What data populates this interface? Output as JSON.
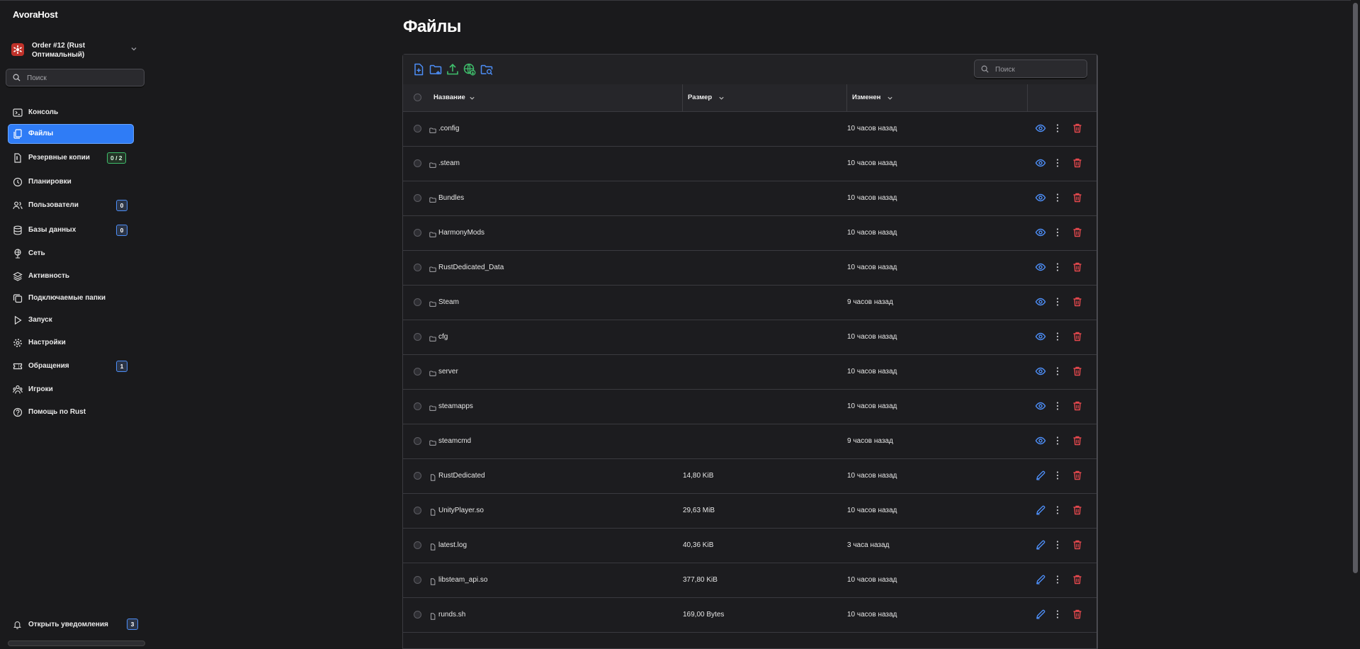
{
  "app": {
    "brand": "AvoraHost"
  },
  "order": {
    "title": "Order #12 (Rust Оптимальный)"
  },
  "sidebar": {
    "search_placeholder": "Поиск",
    "items": [
      {
        "label": "Консоль",
        "icon": "terminal-icon"
      },
      {
        "label": "Файлы",
        "icon": "files-icon",
        "active": true
      },
      {
        "label": "Резервные копии",
        "icon": "backup-icon",
        "badge": "0 / 2"
      },
      {
        "label": "Планировки",
        "icon": "clock-icon"
      },
      {
        "label": "Пользователи",
        "icon": "users-icon",
        "badge": "0"
      },
      {
        "label": "Базы данных",
        "icon": "database-icon",
        "badge": "0"
      },
      {
        "label": "Сеть",
        "icon": "network-icon"
      },
      {
        "label": "Активность",
        "icon": "layers-icon"
      },
      {
        "label": "Подключаемые папки",
        "icon": "mount-icon"
      },
      {
        "label": "Запуск",
        "icon": "play-icon"
      },
      {
        "label": "Настройки",
        "icon": "gear-icon"
      },
      {
        "label": "Обращения",
        "icon": "ticket-icon",
        "badge": "1"
      },
      {
        "label": "Игроки",
        "icon": "players-icon"
      },
      {
        "label": "Помощь по Rust",
        "icon": "help-icon"
      }
    ],
    "notifications": {
      "label": "Открыть уведомления",
      "badge": "3"
    }
  },
  "main": {
    "title": "Файлы",
    "search_placeholder": "Поиск",
    "columns": {
      "name": "Название",
      "size": "Размер",
      "modified": "Изменен"
    },
    "files": [
      {
        "name": ".config",
        "size": "",
        "modified": "10 часов назад",
        "type": "folder"
      },
      {
        "name": ".steam",
        "size": "",
        "modified": "10 часов назад",
        "type": "folder"
      },
      {
        "name": "Bundles",
        "size": "",
        "modified": "10 часов назад",
        "type": "folder"
      },
      {
        "name": "HarmonyMods",
        "size": "",
        "modified": "10 часов назад",
        "type": "folder"
      },
      {
        "name": "RustDedicated_Data",
        "size": "",
        "modified": "10 часов назад",
        "type": "folder"
      },
      {
        "name": "Steam",
        "size": "",
        "modified": "9 часов назад",
        "type": "folder"
      },
      {
        "name": "cfg",
        "size": "",
        "modified": "10 часов назад",
        "type": "folder"
      },
      {
        "name": "server",
        "size": "",
        "modified": "10 часов назад",
        "type": "folder"
      },
      {
        "name": "steamapps",
        "size": "",
        "modified": "10 часов назад",
        "type": "folder"
      },
      {
        "name": "steamcmd",
        "size": "",
        "modified": "9 часов назад",
        "type": "folder"
      },
      {
        "name": "RustDedicated",
        "size": "14,80 KiB",
        "modified": "10 часов назад",
        "type": "file"
      },
      {
        "name": "UnityPlayer.so",
        "size": "29,63 MiB",
        "modified": "10 часов назад",
        "type": "file"
      },
      {
        "name": "latest.log",
        "size": "40,36 KiB",
        "modified": "3 часа назад",
        "type": "file"
      },
      {
        "name": "libsteam_api.so",
        "size": "377,80 KiB",
        "modified": "10 часов назад",
        "type": "file"
      },
      {
        "name": "runds.sh",
        "size": "169,00 Bytes",
        "modified": "10 часов назад",
        "type": "file"
      }
    ]
  },
  "colors": {
    "accent": "#2f7cf6",
    "green": "#3fbf6c",
    "danger": "#e5484d",
    "background": "#1a1a1c"
  }
}
